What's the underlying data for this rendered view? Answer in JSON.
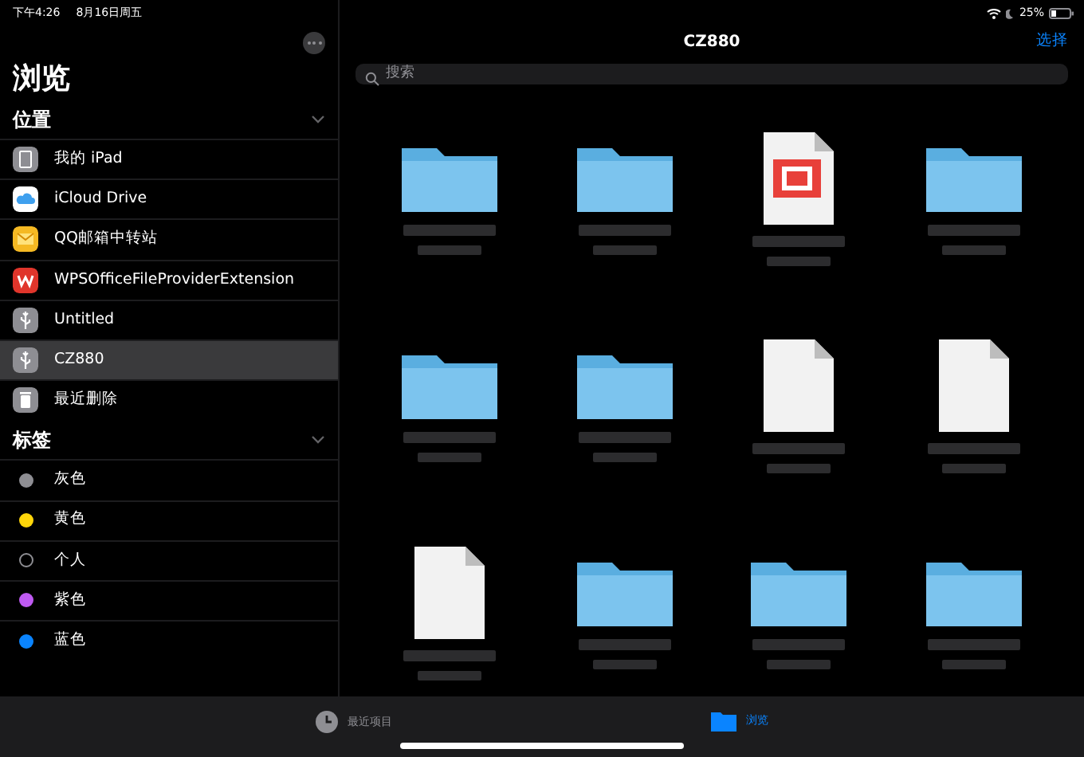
{
  "status_bar": {
    "time": "下午4:26",
    "date": "8月16日周五",
    "battery": "25%"
  },
  "sidebar": {
    "title": "浏览",
    "sections": [
      {
        "title": "位置",
        "expanded": true,
        "items": [
          {
            "label": "我的 iPad",
            "kind": "ipad",
            "selected": false
          },
          {
            "label": "iCloud Drive",
            "kind": "icloud",
            "selected": false
          },
          {
            "label": "QQ邮箱中转站",
            "kind": "mail",
            "selected": false
          },
          {
            "label": "WPSOfficeFileProviderExtension",
            "kind": "wps",
            "selected": false
          },
          {
            "label": "Untitled",
            "kind": "usb",
            "selected": false
          },
          {
            "label": "CZ880",
            "kind": "usb",
            "selected": true
          },
          {
            "label": "最近删除",
            "kind": "trash",
            "selected": false
          }
        ]
      },
      {
        "title": "标签",
        "expanded": true,
        "items": [
          {
            "label": "灰色",
            "kind": "tag",
            "color": "#8e8e93",
            "selected": false
          },
          {
            "label": "黄色",
            "kind": "tag",
            "color": "#ffd60a",
            "selected": false
          },
          {
            "label": "个人",
            "kind": "tag-empty",
            "selected": false
          },
          {
            "label": "紫色",
            "kind": "tag",
            "color": "#bf5af2",
            "selected": false
          },
          {
            "label": "蓝色",
            "kind": "tag",
            "color": "#0a84ff",
            "selected": false
          }
        ]
      }
    ]
  },
  "main": {
    "title": "CZ880",
    "select_button": "选择",
    "search": {
      "placeholder": "搜索"
    },
    "files": [
      {
        "kind": "folder"
      },
      {
        "kind": "folder"
      },
      {
        "kind": "red-document"
      },
      {
        "kind": "folder"
      },
      {
        "kind": "folder"
      },
      {
        "kind": "folder"
      },
      {
        "kind": "document"
      },
      {
        "kind": "document"
      },
      {
        "kind": "document"
      },
      {
        "kind": "folder"
      },
      {
        "kind": "folder"
      },
      {
        "kind": "folder"
      }
    ]
  },
  "tab_bar": [
    {
      "label": "最近项目",
      "kind": "recents",
      "selected": false
    },
    {
      "label": "浏览",
      "kind": "browse",
      "selected": true
    }
  ]
}
